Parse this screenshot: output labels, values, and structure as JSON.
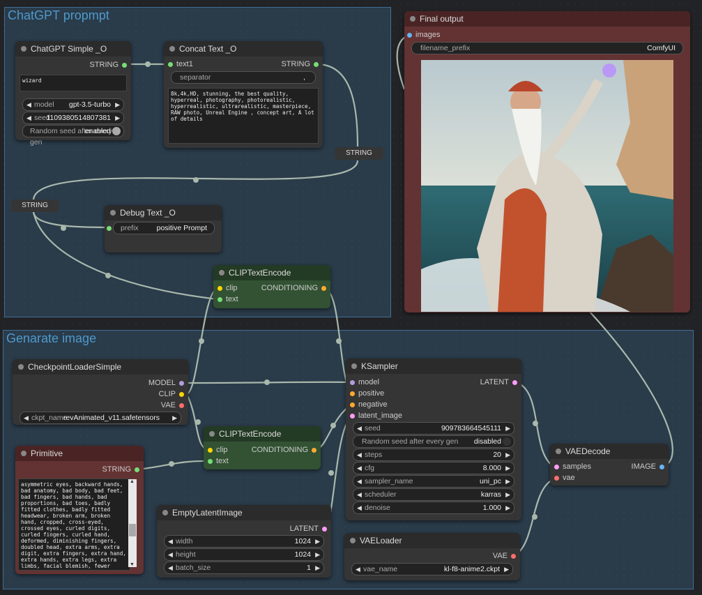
{
  "groups": {
    "prompt": {
      "title": "ChatGPT propmpt"
    },
    "generate": {
      "title": "Genarate image"
    }
  },
  "gpt_node": {
    "title": "ChatGPT Simple _O",
    "out_string": "STRING",
    "text": "wizard",
    "model_label": "model",
    "model_value": "gpt-3.5-turbo",
    "seed_label": "seed",
    "seed_value": "1109380514807381",
    "random_label": "Random seed after every gen",
    "random_value": "enabled"
  },
  "concat_node": {
    "title": "Concat Text _O",
    "in_text1": "text1",
    "out_string": "STRING",
    "separator_label": "separator",
    "separator_value": ",",
    "text": "8k,4k,HD, stunning, the best quality, hyperreal, photography, photorealistic, hyperrealistic, ultrarealistic, masterpiece, RAW photo, Unreal Engine , concept art, A lot of details"
  },
  "reroutes": {
    "r1": "STRING",
    "r2": "STRING"
  },
  "debug_node": {
    "title": "Debug Text _O",
    "prefix_label": "prefix",
    "prefix_value": "positive Prompt"
  },
  "clip_pos": {
    "title": "CLIPTextEncode",
    "in_clip": "clip",
    "in_text": "text",
    "out": "CONDITIONING"
  },
  "final_node": {
    "title": "Final output",
    "in_images": "images",
    "prefix_label": "filename_prefix",
    "prefix_value": "ComfyUI"
  },
  "ckpt_node": {
    "title": "CheckpointLoaderSimple",
    "out_model": "MODEL",
    "out_clip": "CLIP",
    "out_vae": "VAE",
    "ckpt_label": "ckpt_name",
    "ckpt_value": "revAnimated_v11.safetensors"
  },
  "clip_neg": {
    "title": "CLIPTextEncode",
    "in_clip": "clip",
    "in_text": "text",
    "out": "CONDITIONING"
  },
  "primitive": {
    "title": "Primitive",
    "out": "STRING",
    "text": "asymmetric eyes, backward hands, bad anatomy, bad body, bad feet, bad fingers, bad hands, bad proportions, bad toes, badly fitted clothes, badly fitted headwear, broken arm, broken hand, cropped, cross-eyed, crossed eyes, curled digits, curled fingers, curled hand, deformed, diminishing fingers, doubled head, extra arms, extra digit, extra fingers, extra hand, extra hands, extra legs, extra limbs, facial blemish, fewer digits, fewer fingers, fewer"
  },
  "latent_node": {
    "title": "EmptyLatentImage",
    "out": "LATENT",
    "width_label": "width",
    "width_value": "1024",
    "height_label": "height",
    "height_value": "1024",
    "batch_label": "batch_size",
    "batch_value": "1"
  },
  "ksampler": {
    "title": "KSampler",
    "in_model": "model",
    "in_positive": "positive",
    "in_negative": "negative",
    "in_latent": "latent_image",
    "out": "LATENT",
    "seed_label": "seed",
    "seed_value": "909783664545111",
    "random_label": "Random seed after every gen",
    "random_value": "disabled",
    "steps_label": "steps",
    "steps_value": "20",
    "cfg_label": "cfg",
    "cfg_value": "8.000",
    "sampler_label": "sampler_name",
    "sampler_value": "uni_pc",
    "scheduler_label": "scheduler",
    "scheduler_value": "karras",
    "denoise_label": "denoise",
    "denoise_value": "1.000"
  },
  "vaeloader": {
    "title": "VAELoader",
    "out": "VAE",
    "vae_label": "vae_name",
    "vae_value": "kl-f8-anime2.ckpt"
  },
  "vaedecode": {
    "title": "VAEDecode",
    "in_samples": "samples",
    "in_vae": "vae",
    "out": "IMAGE"
  },
  "colors": {
    "clip": "#ffd500",
    "conditioning": "#ffa931",
    "model": "#b39ddb",
    "vae": "#ff6e6e",
    "latent": "#ff9cf9",
    "image": "#64b5f6",
    "string": "#77dd77"
  }
}
